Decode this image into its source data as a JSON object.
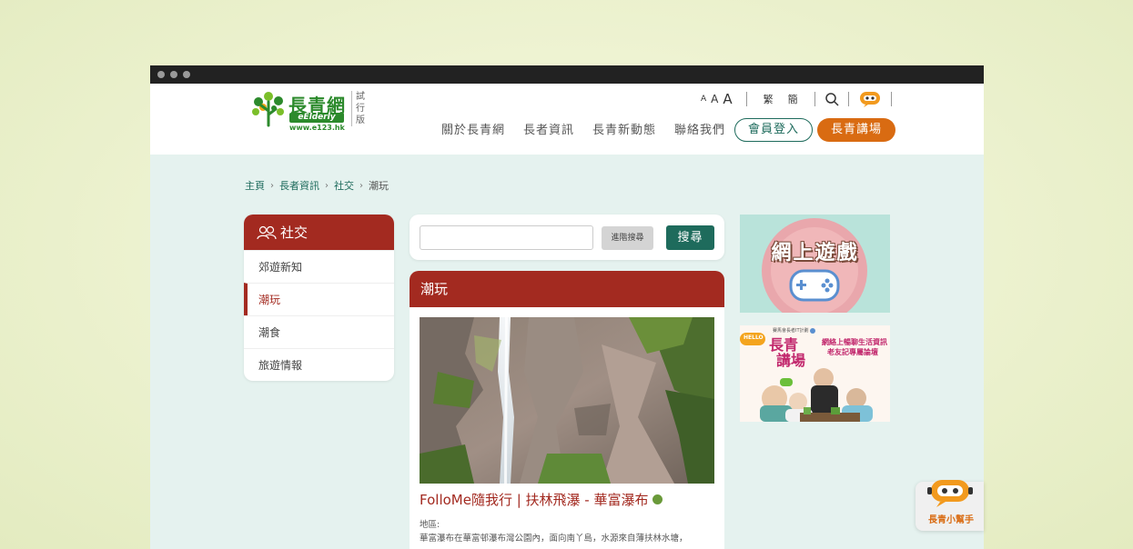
{
  "header": {
    "logo_main": "長青網",
    "logo_badge": "eElderly",
    "logo_url": "www.e123.hk",
    "trial_label": "試行版",
    "font_sizes": [
      "A",
      "A",
      "A"
    ],
    "lang_trad": "繁",
    "lang_simp": "簡",
    "nav": [
      "關於長青網",
      "長者資訊",
      "長青新動態",
      "聯絡我們"
    ],
    "login_label": "會員登入",
    "forum_label": "長青講場"
  },
  "breadcrumb": [
    "主頁",
    "長者資訊",
    "社交",
    "潮玩"
  ],
  "sidebar": {
    "title": "社交",
    "items": [
      "郊遊新知",
      "潮玩",
      "潮食",
      "旅遊情報"
    ],
    "active_index": 1
  },
  "search": {
    "placeholder": "",
    "advanced_label": "進階搜尋",
    "submit_label": "搜尋"
  },
  "content": {
    "section_title": "潮玩",
    "article_title": "FolloMe隨我行 | 扶林飛瀑 - 華富瀑布",
    "body_label": "地區:",
    "body_text": "華富瀑布在華富邨瀑布灣公園內，面向南丫島，水源來自薄扶林水塘，"
  },
  "ads": {
    "games_title": "網上遊戲",
    "forum_badge": "HELLO",
    "forum_title_1": "長青",
    "forum_title_2": "講場",
    "forum_tagline_1": "網絡上暢聊生活資訊",
    "forum_tagline_2": "老友記專屬論壇",
    "forum_small": "賽馬會長者IT計劃"
  },
  "helper": {
    "label": "長青小幫手"
  },
  "colors": {
    "brand_green": "#1e6b5c",
    "brand_red": "#a32a20",
    "brand_orange": "#d96b12",
    "logo_green": "#2c8a2c"
  }
}
